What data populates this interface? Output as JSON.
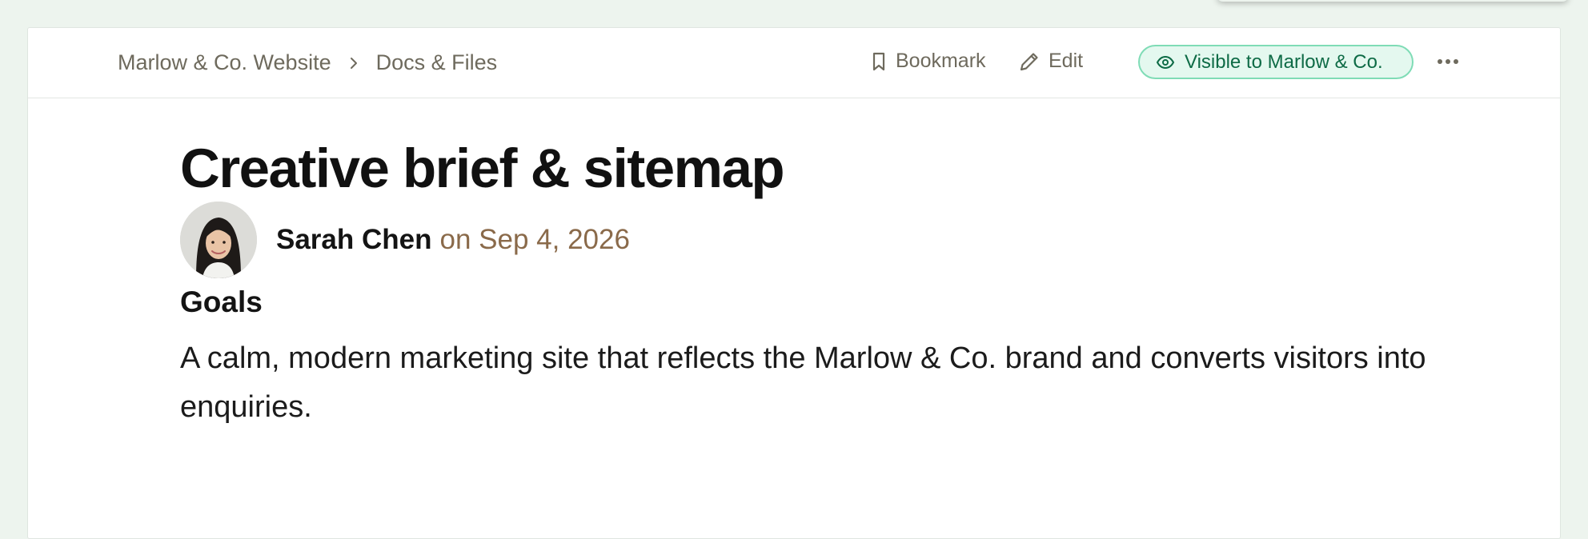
{
  "breadcrumb": {
    "project": "Marlow & Co. Website",
    "section": "Docs & Files"
  },
  "actions": {
    "bookmark_label": "Bookmark",
    "edit_label": "Edit",
    "visibility_label": "Visible to Marlow & Co."
  },
  "document": {
    "title": "Creative brief & sitemap",
    "author": "Sarah Chen",
    "date": "on Sep 4, 2026",
    "section_heading": "Goals",
    "paragraph": "A calm, modern marketing site that reflects the Marlow & Co. brand and converts visitors into enquiries."
  },
  "colors": {
    "page_bg": "#edf4ee",
    "accent_green": "#0e6b46",
    "pill_border": "#7fdcb6",
    "pill_bg": "#e4f8ef",
    "date_brown": "#8a6a4a"
  },
  "icons": {
    "breadcrumb_separator": "chevron-right-icon",
    "bookmark": "bookmark-icon",
    "edit": "pencil-icon",
    "visibility": "eye-icon",
    "more": "more-dots-icon"
  }
}
